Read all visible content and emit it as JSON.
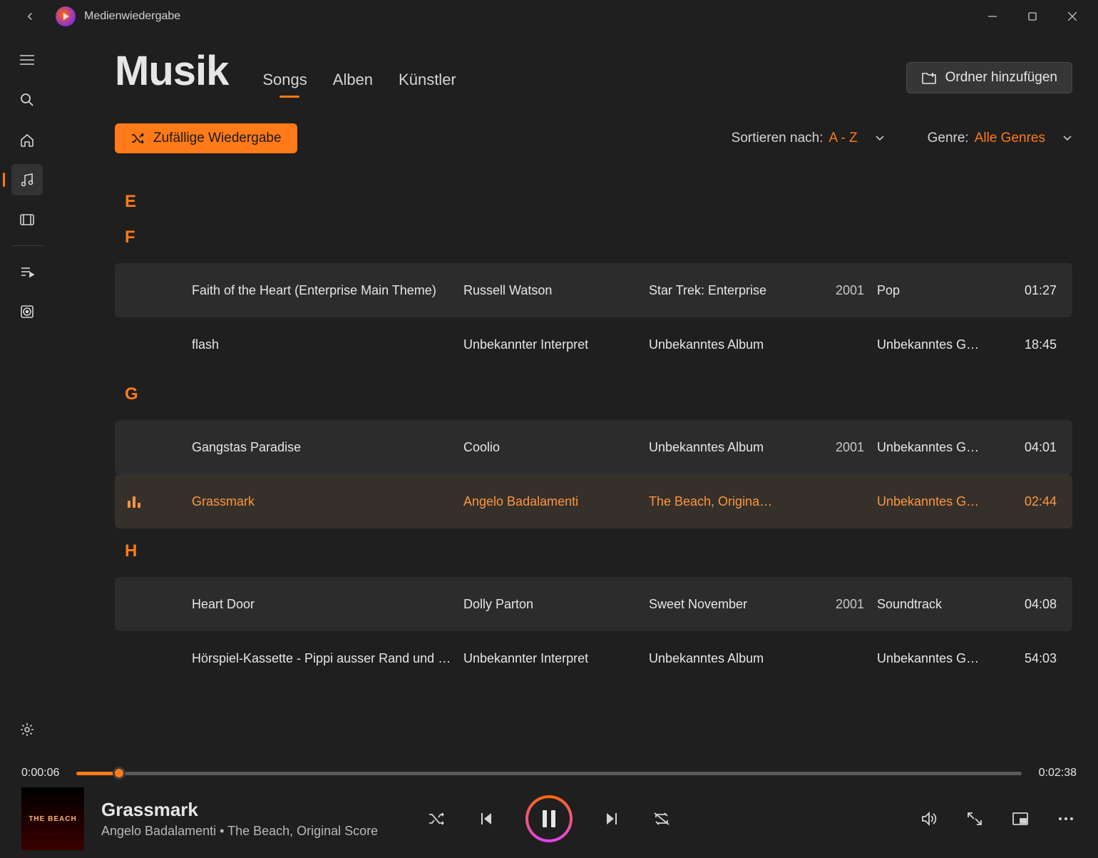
{
  "window": {
    "title": "Medienwiedergabe"
  },
  "page": {
    "title": "Musik",
    "tabs": [
      "Songs",
      "Alben",
      "Künstler"
    ],
    "activeTabIndex": 0,
    "addFolder": "Ordner hinzufügen",
    "shuffle": "Zufällige Wiedergabe",
    "sortLabel": "Sortieren nach:",
    "sortValue": "A - Z",
    "genreLabel": "Genre:",
    "genreValue": "Alle Genres"
  },
  "sections": [
    {
      "letter": "E",
      "rows": []
    },
    {
      "letter": "F",
      "rows": [
        {
          "title": "Faith of the Heart (Enterprise Main Theme)",
          "artist": "Russell Watson",
          "album": "Star Trek: Enterprise",
          "year": "2001",
          "genre": "Pop",
          "duration": "01:27",
          "alt": true
        },
        {
          "title": "flash",
          "artist": "Unbekannter Interpret",
          "album": "Unbekanntes Album",
          "year": "",
          "genre": "Unbekanntes G…",
          "duration": "18:45",
          "alt": false
        }
      ]
    },
    {
      "letter": "G",
      "rows": [
        {
          "title": "Gangstas Paradise",
          "artist": "Coolio",
          "album": "Unbekanntes Album",
          "year": "2001",
          "genre": "Unbekanntes G…",
          "duration": "04:01",
          "alt": true
        },
        {
          "title": "Grassmark",
          "artist": "Angelo Badalamenti",
          "album": "The Beach, Origina…",
          "year": "",
          "genre": "Unbekanntes G…",
          "duration": "02:44",
          "alt": false,
          "playing": true
        }
      ]
    },
    {
      "letter": "H",
      "rows": [
        {
          "title": "Heart Door",
          "artist": "Dolly Parton",
          "album": "Sweet November",
          "year": "2001",
          "genre": "Soundtrack",
          "duration": "04:08",
          "alt": true
        },
        {
          "title": "Hörspiel-Kassette -  Pippi ausser Rand und Band",
          "artist": "Unbekannter Interpret",
          "album": "Unbekanntes Album",
          "year": "",
          "genre": "Unbekanntes G…",
          "duration": "54:03",
          "alt": false
        }
      ]
    }
  ],
  "progress": {
    "elapsed": "0:00:06",
    "total": "0:02:38"
  },
  "nowPlaying": {
    "title": "Grassmark",
    "subtitle": "Angelo Badalamenti • The Beach, Original Score",
    "art": "THE BEACH"
  }
}
